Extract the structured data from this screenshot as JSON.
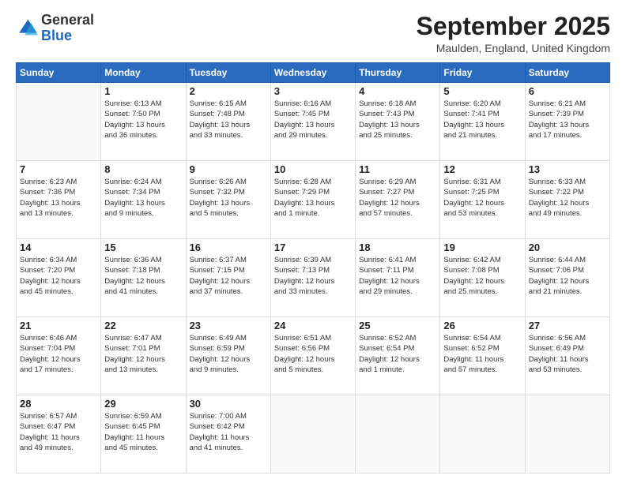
{
  "logo": {
    "general": "General",
    "blue": "Blue"
  },
  "header": {
    "month": "September 2025",
    "location": "Maulden, England, United Kingdom"
  },
  "weekdays": [
    "Sunday",
    "Monday",
    "Tuesday",
    "Wednesday",
    "Thursday",
    "Friday",
    "Saturday"
  ],
  "weeks": [
    [
      {
        "day": "",
        "info": ""
      },
      {
        "day": "1",
        "info": "Sunrise: 6:13 AM\nSunset: 7:50 PM\nDaylight: 13 hours\nand 36 minutes."
      },
      {
        "day": "2",
        "info": "Sunrise: 6:15 AM\nSunset: 7:48 PM\nDaylight: 13 hours\nand 33 minutes."
      },
      {
        "day": "3",
        "info": "Sunrise: 6:16 AM\nSunset: 7:45 PM\nDaylight: 13 hours\nand 29 minutes."
      },
      {
        "day": "4",
        "info": "Sunrise: 6:18 AM\nSunset: 7:43 PM\nDaylight: 13 hours\nand 25 minutes."
      },
      {
        "day": "5",
        "info": "Sunrise: 6:20 AM\nSunset: 7:41 PM\nDaylight: 13 hours\nand 21 minutes."
      },
      {
        "day": "6",
        "info": "Sunrise: 6:21 AM\nSunset: 7:39 PM\nDaylight: 13 hours\nand 17 minutes."
      }
    ],
    [
      {
        "day": "7",
        "info": "Sunrise: 6:23 AM\nSunset: 7:36 PM\nDaylight: 13 hours\nand 13 minutes."
      },
      {
        "day": "8",
        "info": "Sunrise: 6:24 AM\nSunset: 7:34 PM\nDaylight: 13 hours\nand 9 minutes."
      },
      {
        "day": "9",
        "info": "Sunrise: 6:26 AM\nSunset: 7:32 PM\nDaylight: 13 hours\nand 5 minutes."
      },
      {
        "day": "10",
        "info": "Sunrise: 6:28 AM\nSunset: 7:29 PM\nDaylight: 13 hours\nand 1 minute."
      },
      {
        "day": "11",
        "info": "Sunrise: 6:29 AM\nSunset: 7:27 PM\nDaylight: 12 hours\nand 57 minutes."
      },
      {
        "day": "12",
        "info": "Sunrise: 6:31 AM\nSunset: 7:25 PM\nDaylight: 12 hours\nand 53 minutes."
      },
      {
        "day": "13",
        "info": "Sunrise: 6:33 AM\nSunset: 7:22 PM\nDaylight: 12 hours\nand 49 minutes."
      }
    ],
    [
      {
        "day": "14",
        "info": "Sunrise: 6:34 AM\nSunset: 7:20 PM\nDaylight: 12 hours\nand 45 minutes."
      },
      {
        "day": "15",
        "info": "Sunrise: 6:36 AM\nSunset: 7:18 PM\nDaylight: 12 hours\nand 41 minutes."
      },
      {
        "day": "16",
        "info": "Sunrise: 6:37 AM\nSunset: 7:15 PM\nDaylight: 12 hours\nand 37 minutes."
      },
      {
        "day": "17",
        "info": "Sunrise: 6:39 AM\nSunset: 7:13 PM\nDaylight: 12 hours\nand 33 minutes."
      },
      {
        "day": "18",
        "info": "Sunrise: 6:41 AM\nSunset: 7:11 PM\nDaylight: 12 hours\nand 29 minutes."
      },
      {
        "day": "19",
        "info": "Sunrise: 6:42 AM\nSunset: 7:08 PM\nDaylight: 12 hours\nand 25 minutes."
      },
      {
        "day": "20",
        "info": "Sunrise: 6:44 AM\nSunset: 7:06 PM\nDaylight: 12 hours\nand 21 minutes."
      }
    ],
    [
      {
        "day": "21",
        "info": "Sunrise: 6:46 AM\nSunset: 7:04 PM\nDaylight: 12 hours\nand 17 minutes."
      },
      {
        "day": "22",
        "info": "Sunrise: 6:47 AM\nSunset: 7:01 PM\nDaylight: 12 hours\nand 13 minutes."
      },
      {
        "day": "23",
        "info": "Sunrise: 6:49 AM\nSunset: 6:59 PM\nDaylight: 12 hours\nand 9 minutes."
      },
      {
        "day": "24",
        "info": "Sunrise: 6:51 AM\nSunset: 6:56 PM\nDaylight: 12 hours\nand 5 minutes."
      },
      {
        "day": "25",
        "info": "Sunrise: 6:52 AM\nSunset: 6:54 PM\nDaylight: 12 hours\nand 1 minute."
      },
      {
        "day": "26",
        "info": "Sunrise: 6:54 AM\nSunset: 6:52 PM\nDaylight: 11 hours\nand 57 minutes."
      },
      {
        "day": "27",
        "info": "Sunrise: 6:56 AM\nSunset: 6:49 PM\nDaylight: 11 hours\nand 53 minutes."
      }
    ],
    [
      {
        "day": "28",
        "info": "Sunrise: 6:57 AM\nSunset: 6:47 PM\nDaylight: 11 hours\nand 49 minutes."
      },
      {
        "day": "29",
        "info": "Sunrise: 6:59 AM\nSunset: 6:45 PM\nDaylight: 11 hours\nand 45 minutes."
      },
      {
        "day": "30",
        "info": "Sunrise: 7:00 AM\nSunset: 6:42 PM\nDaylight: 11 hours\nand 41 minutes."
      },
      {
        "day": "",
        "info": ""
      },
      {
        "day": "",
        "info": ""
      },
      {
        "day": "",
        "info": ""
      },
      {
        "day": "",
        "info": ""
      }
    ]
  ]
}
